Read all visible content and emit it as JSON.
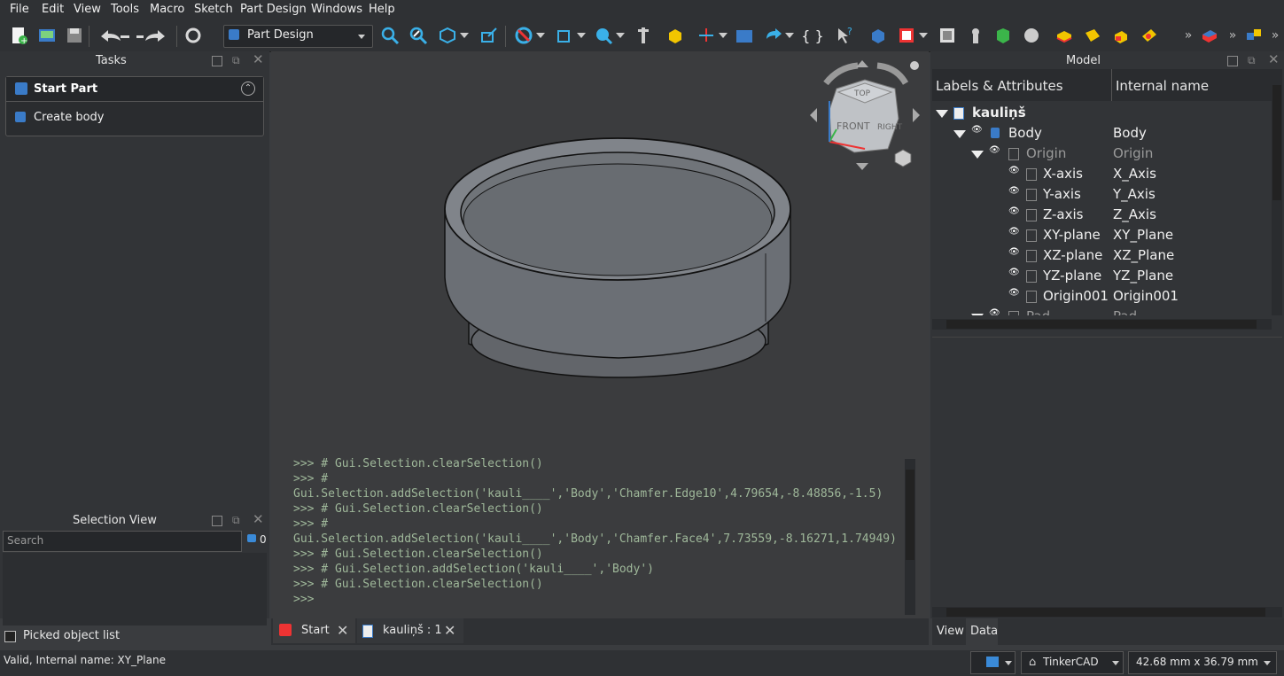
{
  "menubar": {
    "items": [
      "File",
      "Edit",
      "View",
      "Tools",
      "Macro",
      "Sketch",
      "Part Design",
      "Windows",
      "Help"
    ]
  },
  "toolbar": {
    "workbench": "Part Design",
    "icons": [
      "new-file",
      "open-file",
      "save",
      "undo",
      "redo",
      "refresh",
      "fit-all",
      "fit-selection",
      "view-isometric",
      "std-view-box-zoom",
      "draw-style",
      "bounding-box",
      "zoom",
      "measure",
      "part",
      "axis-cross",
      "folder",
      "link",
      "braces",
      "whats-this",
      "body",
      "sketch",
      "validate-sketch",
      "point",
      "additive",
      "subtractive",
      "pad",
      "pocket",
      "revolution",
      "groove",
      "boolean",
      "pattern"
    ]
  },
  "tasks": {
    "title": "Tasks",
    "section_title": "Start Part",
    "create_body": "Create body"
  },
  "selection_view": {
    "title": "Selection View",
    "search_placeholder": "Search",
    "count": "0",
    "picked_label": "Picked object list"
  },
  "model": {
    "title": "Model",
    "col_labels": "Labels & Attributes",
    "col_internal": "Internal name",
    "tree": [
      {
        "label": "kauliņš",
        "internal": "",
        "indent": 0,
        "dim": false,
        "bold": true
      },
      {
        "label": "Body",
        "internal": "Body",
        "indent": 1,
        "dim": false,
        "bold": false
      },
      {
        "label": "Origin",
        "internal": "Origin",
        "indent": 2,
        "dim": true,
        "bold": false
      },
      {
        "label": "X-axis",
        "internal": "X_Axis",
        "indent": 3,
        "dim": false,
        "bold": false
      },
      {
        "label": "Y-axis",
        "internal": "Y_Axis",
        "indent": 3,
        "dim": false,
        "bold": false
      },
      {
        "label": "Z-axis",
        "internal": "Z_Axis",
        "indent": 3,
        "dim": false,
        "bold": false
      },
      {
        "label": "XY-plane",
        "internal": "XY_Plane",
        "indent": 3,
        "dim": false,
        "bold": false
      },
      {
        "label": "XZ-plane",
        "internal": "XZ_Plane",
        "indent": 3,
        "dim": false,
        "bold": false
      },
      {
        "label": "YZ-plane",
        "internal": "YZ_Plane",
        "indent": 3,
        "dim": false,
        "bold": false
      },
      {
        "label": "Origin001",
        "internal": "Origin001",
        "indent": 3,
        "dim": false,
        "bold": false
      },
      {
        "label": "Pad",
        "internal": "Pad",
        "indent": 2,
        "dim": true,
        "bold": false
      }
    ],
    "tabs": [
      "View",
      "Data"
    ]
  },
  "navcube": {
    "top": "TOP",
    "front": "FRONT",
    "right": "RIGHT"
  },
  "console": {
    "lines": [
      ">>> # Gui.Selection.clearSelection()",
      ">>> #",
      "Gui.Selection.addSelection('kauli____','Body','Chamfer.Edge10',4.79654,-8.48856,-1.5)",
      ">>> # Gui.Selection.clearSelection()",
      ">>> #",
      "Gui.Selection.addSelection('kauli____','Body','Chamfer.Face4',7.73559,-8.16271,1.74949)",
      ">>> # Gui.Selection.clearSelection()",
      ">>> # Gui.Selection.addSelection('kauli____','Body')",
      ">>> # Gui.Selection.clearSelection()",
      ">>>"
    ]
  },
  "doc_tabs": [
    "Start",
    "kauliņš : 1"
  ],
  "statusbar": {
    "message": "Valid, Internal name: XY_Plane",
    "nav_style": "TinkerCAD",
    "dimensions": "42.68 mm x 36.79 mm"
  },
  "colors": {
    "accent": "#2a82da",
    "bg": "#3a3c3f"
  }
}
